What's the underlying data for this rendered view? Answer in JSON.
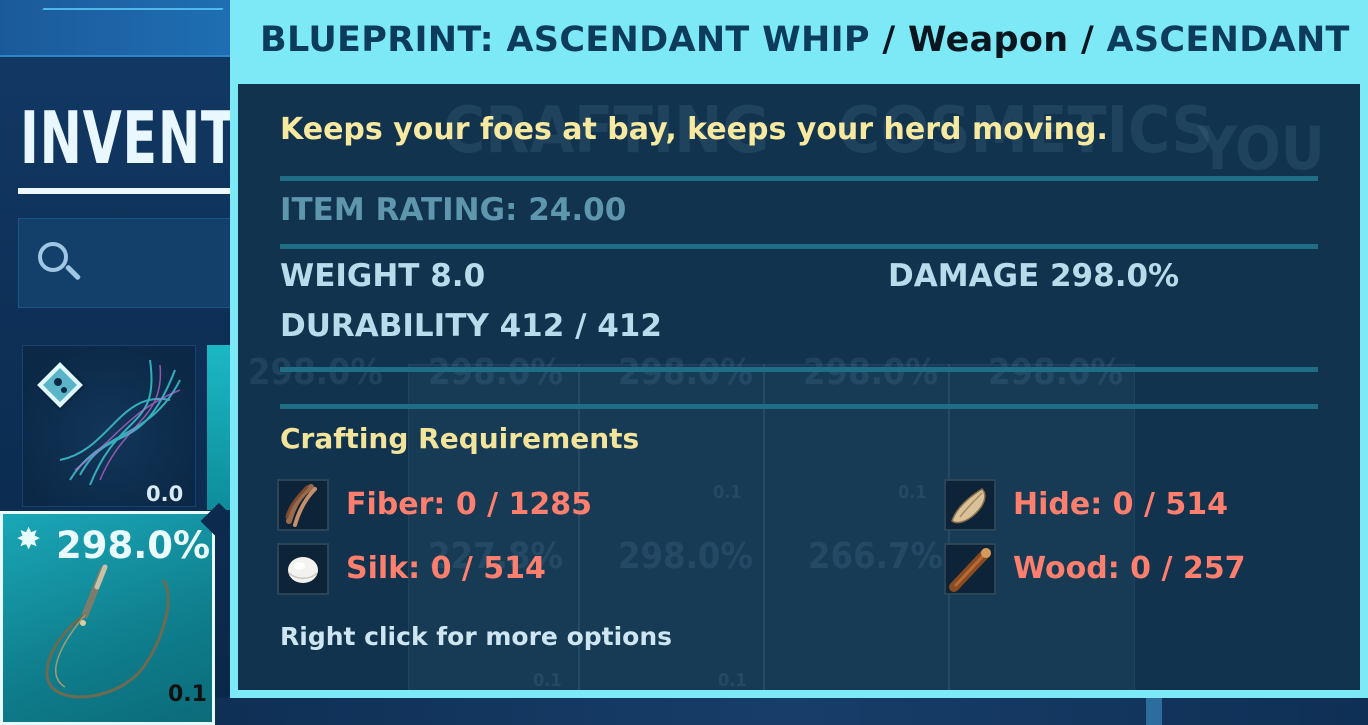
{
  "background": {
    "inventory_title": "INVENTORY",
    "selected_slot": {
      "value": "298.0%",
      "weight": "0.1",
      "icon": "whip-icon",
      "star_icon": "star-burst-icon"
    },
    "slot_a": {
      "weight": "0.0",
      "icon": "blueprint-icon"
    },
    "ghost_tabs": [
      "CRAFTING",
      "COSMETICS",
      "YOU"
    ],
    "ghost_row1": [
      "298.0%",
      "298.0%",
      "298.0%",
      "298.0%",
      "298.0%"
    ],
    "ghost_row2": [
      "227.8%",
      "298.0%",
      "266.7%"
    ],
    "ghost_weights": [
      "0.1",
      "0.1",
      "0.1",
      "0.1"
    ]
  },
  "tooltip": {
    "header": {
      "name": "BLUEPRINT: ASCENDANT WHIP",
      "sep1": " / ",
      "type": "Weapon",
      "sep2": " / ",
      "quality": "ASCENDANT"
    },
    "description": "Keeps your foes at bay, keeps your herd moving.",
    "item_rating": "ITEM RATING: 24.00",
    "stats": {
      "weight": "WEIGHT 8.0",
      "damage": "DAMAGE 298.0%",
      "durability": "DURABILITY 412 / 412"
    },
    "crafting": {
      "title": "Crafting Requirements",
      "resources": [
        {
          "label": "Fiber: 0 / 1285",
          "icon": "fiber-icon"
        },
        {
          "label": "Hide: 0 / 514",
          "icon": "hide-icon"
        },
        {
          "label": "Silk: 0 / 514",
          "icon": "silk-icon"
        },
        {
          "label": "Wood: 0 / 257",
          "icon": "wood-icon"
        }
      ]
    },
    "hint": "Right click for more options"
  },
  "colors": {
    "tooltip_frame": "#7ee9f6",
    "tooltip_body": "#0a2540",
    "description": "#f7e9a0",
    "missing_resource": "#ff7f6e",
    "stat_text": "#b9dcec"
  }
}
